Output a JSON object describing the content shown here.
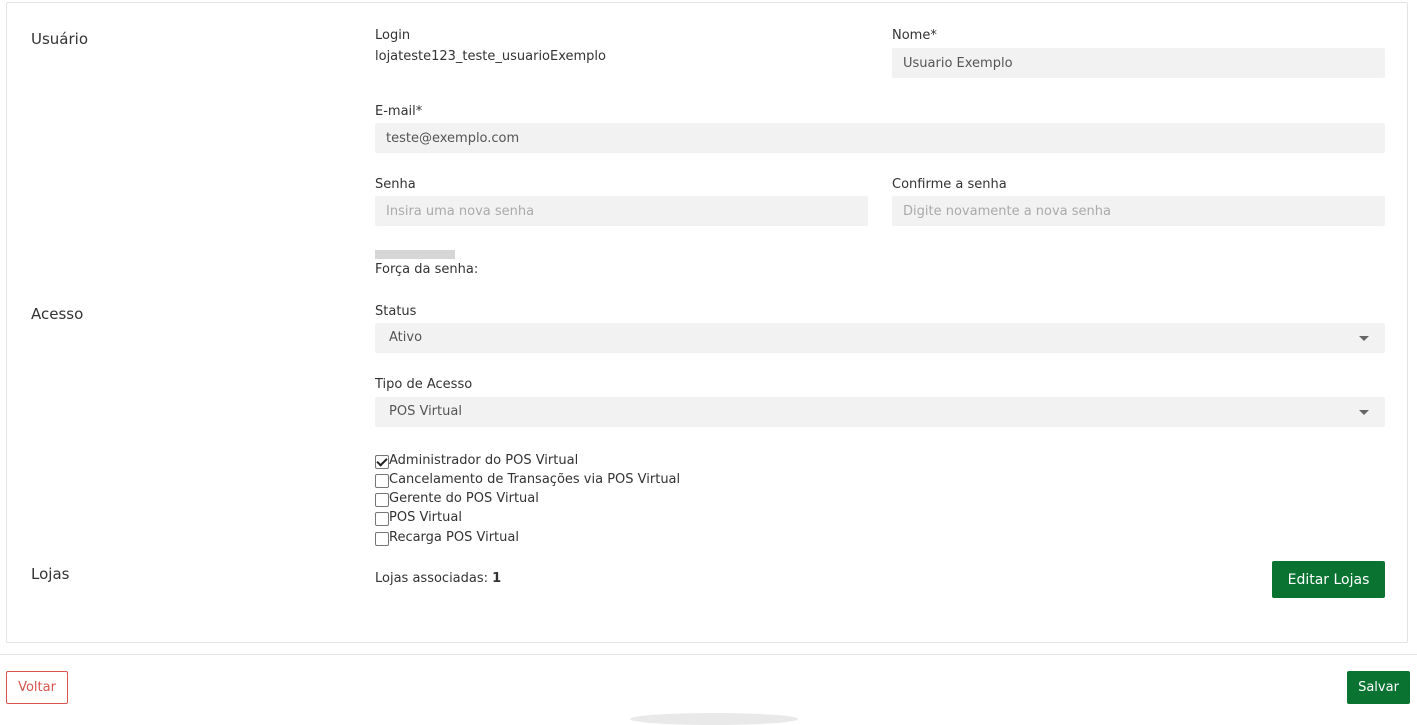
{
  "sections": {
    "usuario": "Usuário",
    "acesso": "Acesso",
    "lojas": "Lojas"
  },
  "login": {
    "label": "Login",
    "value": "lojateste123_teste_usuarioExemplo"
  },
  "nome": {
    "label": "Nome*",
    "value": "Usuario Exemplo"
  },
  "email": {
    "label": "E-mail*",
    "value": "teste@exemplo.com"
  },
  "senha": {
    "label": "Senha",
    "placeholder": "Insira uma nova senha"
  },
  "confirme": {
    "label": "Confirme a senha",
    "placeholder": "Digite novamente a nova senha"
  },
  "forca": {
    "label": "Força da senha:"
  },
  "status": {
    "label": "Status",
    "value": "Ativo"
  },
  "tipo_acesso": {
    "label": "Tipo de Acesso",
    "value": "POS Virtual"
  },
  "permissoes": [
    {
      "label": "Administrador do POS Virtual",
      "checked": true
    },
    {
      "label": "Cancelamento de Transações via POS Virtual",
      "checked": false
    },
    {
      "label": "Gerente do POS Virtual",
      "checked": false
    },
    {
      "label": "POS Virtual",
      "checked": false
    },
    {
      "label": "Recarga POS Virtual",
      "checked": false
    }
  ],
  "lojas": {
    "label": "Lojas associadas:",
    "count": "1",
    "edit_button": "Editar Lojas"
  },
  "footer": {
    "back_button": "Voltar",
    "save_button": "Salvar"
  },
  "colors": {
    "primary_green": "#0a7332",
    "danger_red": "#d9534f",
    "input_bg": "#f2f2f2"
  }
}
